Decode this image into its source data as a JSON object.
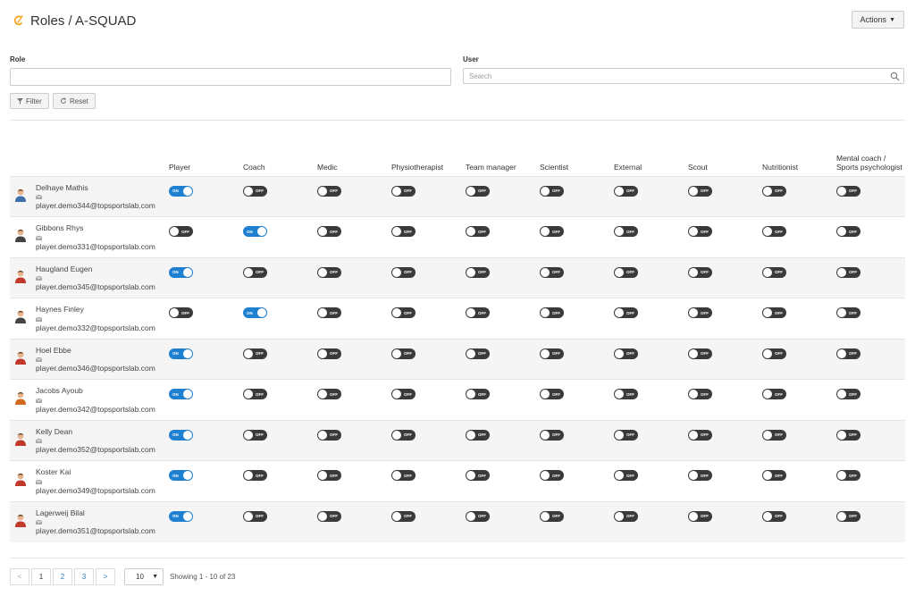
{
  "header": {
    "title": "Roles / A-SQUAD",
    "actions_label": "Actions"
  },
  "filters": {
    "role_label": "Role",
    "role_value": "",
    "user_label": "User",
    "user_placeholder": "Search",
    "filter_button": "Filter",
    "reset_button": "Reset"
  },
  "columns": [
    "Player",
    "Coach",
    "Medic",
    "Physiotherapist",
    "Team manager",
    "Scientist",
    "External",
    "Scout",
    "Nutritionist",
    "Mental coach / Sports psychologist"
  ],
  "rows": [
    {
      "name": "Delhaye Mathis",
      "email": "player.demo344@topsportslab.com",
      "avatar": "male-avatar-blue",
      "roles": [
        true,
        false,
        false,
        false,
        false,
        false,
        false,
        false,
        false,
        false
      ]
    },
    {
      "name": "Gibbons Rhys",
      "email": "player.demo331@topsportslab.com",
      "avatar": "male-avatar-dark",
      "roles": [
        false,
        true,
        false,
        false,
        false,
        false,
        false,
        false,
        false,
        false
      ]
    },
    {
      "name": "Haugland Eugen",
      "email": "player.demo345@topsportslab.com",
      "avatar": "male-avatar-red",
      "roles": [
        true,
        false,
        false,
        false,
        false,
        false,
        false,
        false,
        false,
        false
      ]
    },
    {
      "name": "Haynes Finley",
      "email": "player.demo332@topsportslab.com",
      "avatar": "male-avatar-dark",
      "roles": [
        false,
        true,
        false,
        false,
        false,
        false,
        false,
        false,
        false,
        false
      ]
    },
    {
      "name": "Hoel Ebbe",
      "email": "player.demo346@topsportslab.com",
      "avatar": "male-avatar-red",
      "roles": [
        true,
        false,
        false,
        false,
        false,
        false,
        false,
        false,
        false,
        false
      ]
    },
    {
      "name": "Jacobs Ayoub",
      "email": "player.demo342@topsportslab.com",
      "avatar": "male-avatar-orange",
      "roles": [
        true,
        false,
        false,
        false,
        false,
        false,
        false,
        false,
        false,
        false
      ]
    },
    {
      "name": "Kelly Dean",
      "email": "player.demo352@topsportslab.com",
      "avatar": "male-avatar-red",
      "roles": [
        true,
        false,
        false,
        false,
        false,
        false,
        false,
        false,
        false,
        false
      ]
    },
    {
      "name": "Koster Kai",
      "email": "player.demo349@topsportslab.com",
      "avatar": "male-avatar-red",
      "roles": [
        true,
        false,
        false,
        false,
        false,
        false,
        false,
        false,
        false,
        false
      ]
    },
    {
      "name": "Lagerweij Bilal",
      "email": "player.demo351@topsportslab.com",
      "avatar": "male-avatar-red",
      "roles": [
        true,
        false,
        false,
        false,
        false,
        false,
        false,
        false,
        false,
        false
      ]
    }
  ],
  "toggle": {
    "on": "ON",
    "off": "OFF"
  },
  "pagination": {
    "prev": "<",
    "next": ">",
    "pages": [
      "1",
      "2",
      "3"
    ],
    "page_size": "10",
    "showing": "Showing 1 - 10 of 23"
  },
  "colors": {
    "toggle_on": "#1f7fd0",
    "toggle_off": "#3a3a3a",
    "logo": "#f5a623"
  }
}
